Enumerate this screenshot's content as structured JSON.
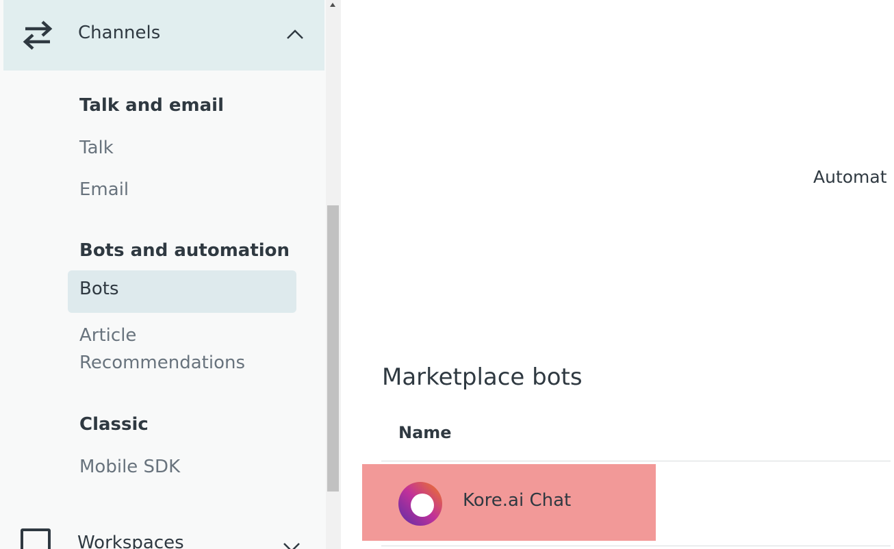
{
  "sidebar": {
    "channels": {
      "label": "Channels",
      "icon": "arrows-swap-icon",
      "expanded": true
    },
    "groups": [
      {
        "title": "Talk and email",
        "items": [
          {
            "label": "Talk"
          },
          {
            "label": "Email"
          }
        ]
      },
      {
        "title": "Bots and automation",
        "items": [
          {
            "label": "Bots",
            "selected": true
          },
          {
            "label": "Article Recommendations"
          }
        ]
      },
      {
        "title": "Classic",
        "items": [
          {
            "label": "Mobile SDK"
          }
        ]
      }
    ],
    "workspaces": {
      "label": "Workspaces",
      "icon": "square-icon",
      "expanded": false
    }
  },
  "main": {
    "automate_text": "Automat",
    "marketplace": {
      "title": "Marketplace bots",
      "column_name": "Name",
      "rows": [
        {
          "name": "Kore.ai Chat",
          "logo": "kore-ai-logo-icon"
        }
      ]
    }
  },
  "colors": {
    "sidebar_bg": "#f8f9f9",
    "active_header_bg": "#e1eeef",
    "selected_item_bg": "#deeaed",
    "highlight_row": "#f29998",
    "text_primary": "#2f3941",
    "text_secondary": "#68737d"
  }
}
